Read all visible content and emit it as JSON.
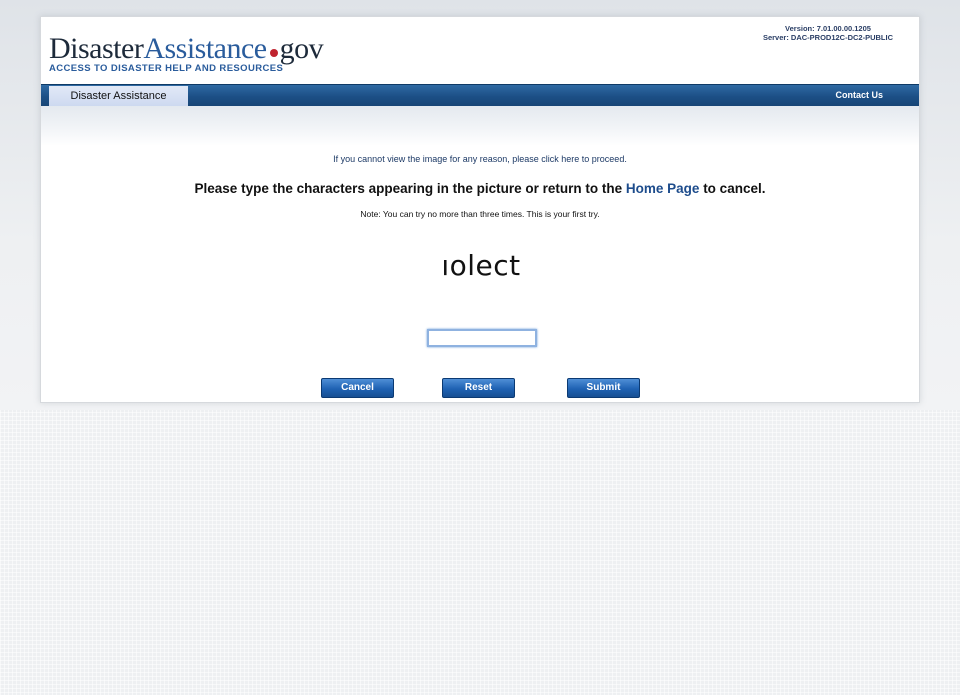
{
  "header": {
    "logo": {
      "part1": "Disaster",
      "part2": "Assistance",
      "part3": "gov",
      "tagline": "ACCESS TO DISASTER HELP AND RESOURCES"
    },
    "version": "Version: 7.01.00.00.1205",
    "server": "Server: DAC-PROD12C-DC2-PUBLIC"
  },
  "nav": {
    "active_tab": "Disaster Assistance",
    "contact": "Contact Us"
  },
  "content": {
    "intro": "If you cannot view the image for any reason, please click here to proceed.",
    "heading_prefix": "Please type the characters appearing in the picture or return to the ",
    "home_link": "Home Page",
    "heading_suffix": " to cancel.",
    "note": "Note: You can try no more than three times. This is your first try.",
    "captcha_text": "ıolect",
    "input_value": ""
  },
  "buttons": {
    "cancel": "Cancel",
    "reset": "Reset",
    "submit": "Submit"
  },
  "colors": {
    "nav_blue": "#1c4f86",
    "tab_bg": "#cdd9f0",
    "button_blue": "#1f62b3",
    "logo_red_dot": "#c0232f"
  }
}
